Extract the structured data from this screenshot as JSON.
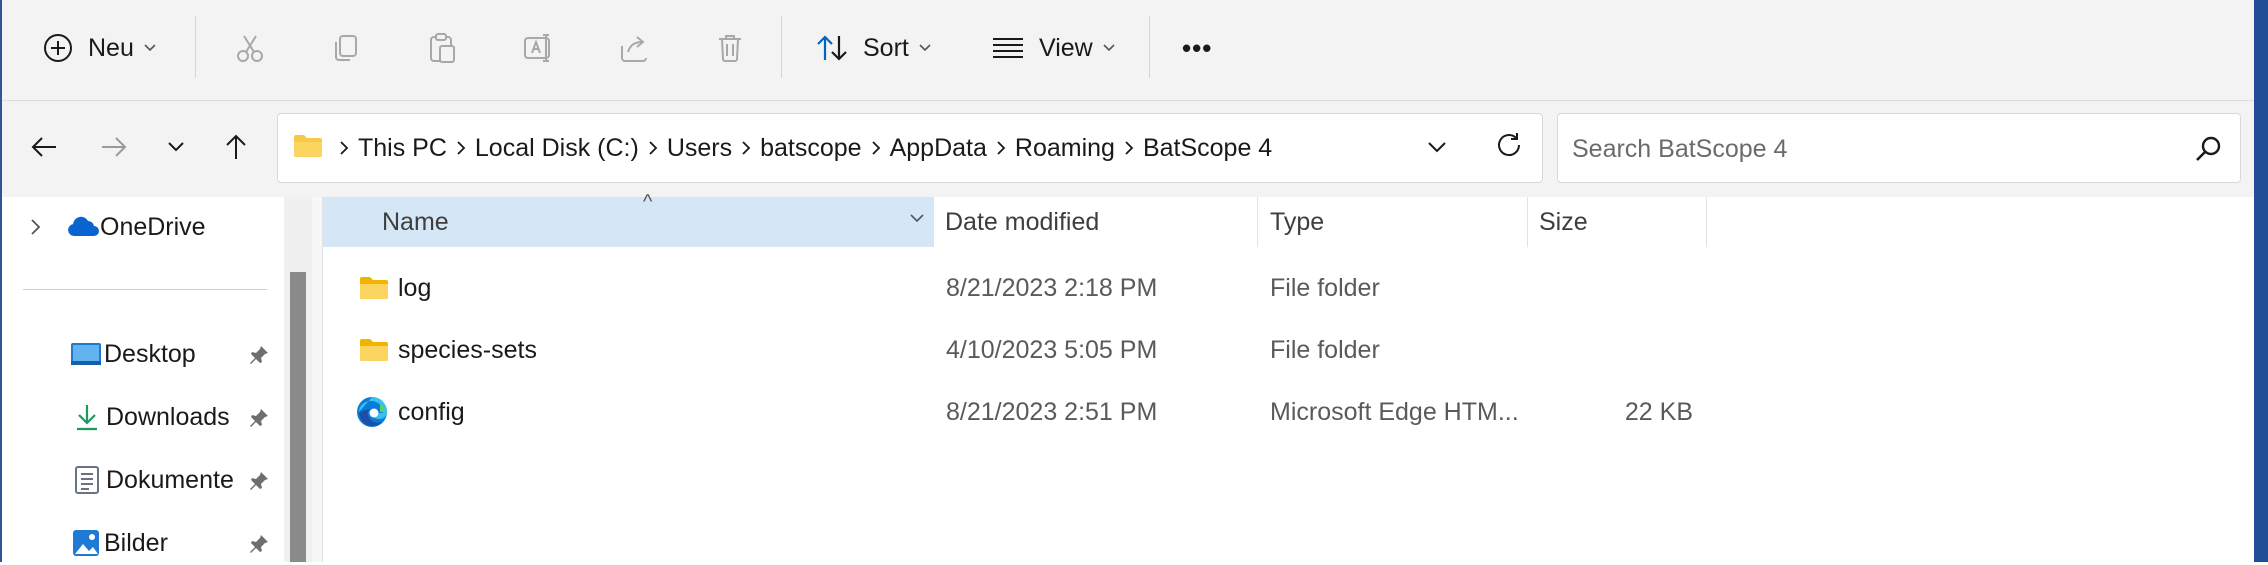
{
  "toolbar": {
    "new_label": "Neu",
    "sort_label": "Sort",
    "view_label": "View",
    "more_label": "•••",
    "icons": [
      "plus-circle-icon",
      "cut-icon",
      "copy-icon",
      "paste-icon",
      "rename-icon",
      "share-icon",
      "delete-icon",
      "sort-icon",
      "view-icon",
      "more-icon"
    ]
  },
  "address": {
    "breadcrumbs": [
      "This PC",
      "Local Disk (C:)",
      "Users",
      "batscope",
      "AppData",
      "Roaming",
      "BatScope 4"
    ]
  },
  "search": {
    "placeholder": "Search BatScope 4"
  },
  "nav": {
    "items": [
      {
        "label": "OneDrive",
        "icon": "cloud-icon",
        "pinned": false
      },
      {
        "label": "Desktop",
        "icon": "desktop-icon",
        "pinned": true
      },
      {
        "label": "Downloads",
        "icon": "download-icon",
        "pinned": true
      },
      {
        "label": "Dokumente",
        "icon": "document-icon",
        "pinned": true
      },
      {
        "label": "Bilder",
        "icon": "picture-icon",
        "pinned": true
      }
    ]
  },
  "table": {
    "columns": [
      "Name",
      "Date modified",
      "Type",
      "Size"
    ],
    "sort_indicator": "^",
    "rows": [
      {
        "name": "log",
        "date": "8/21/2023 2:18 PM",
        "type": "File folder",
        "size": "",
        "icon": "folder-icon"
      },
      {
        "name": "species-sets",
        "date": "4/10/2023 5:05 PM",
        "type": "File folder",
        "size": "",
        "icon": "folder-icon"
      },
      {
        "name": "config",
        "date": "8/21/2023 2:51 PM",
        "type": "Microsoft Edge HTM...",
        "size": "22 KB",
        "icon": "edge-icon"
      }
    ]
  },
  "colors": {
    "accent": "#0067c0",
    "folder": "#f8c848",
    "header_selected": "#d5e6f7",
    "window_frame": "#1f4e96"
  }
}
